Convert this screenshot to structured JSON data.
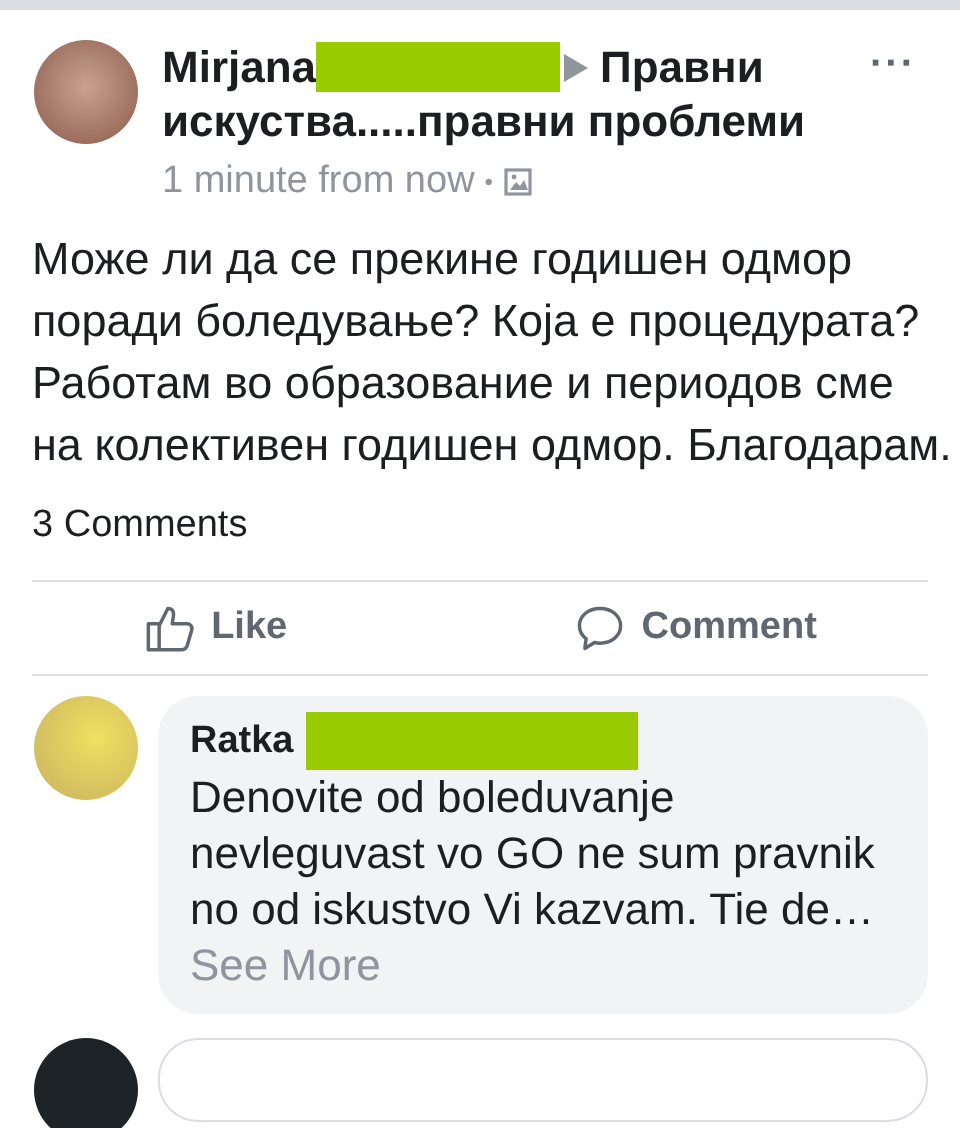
{
  "post": {
    "author": "Mirjana",
    "group": [
      "Правни",
      "искуства.....правни проблеми"
    ],
    "time": "1 minute from now",
    "separator": "•",
    "more": "···",
    "body": "Може ли да се прекине годишен одмор поради боледување? Која е процедурата? Работам во образование и периодов сме на колективен годишен одмор. Благодарам.",
    "comments_count": "3 Comments"
  },
  "actions": [
    {
      "kind": "like",
      "label": "Like"
    },
    {
      "kind": "comment",
      "label": "Comment"
    }
  ],
  "comments": [
    {
      "author": "Ratka",
      "text": "Denovite od boleduvanje nevleguvast vo GO ne sum pravnik no od iskustvo Vi kazvam. Tie de…",
      "see_more": "See More"
    }
  ]
}
